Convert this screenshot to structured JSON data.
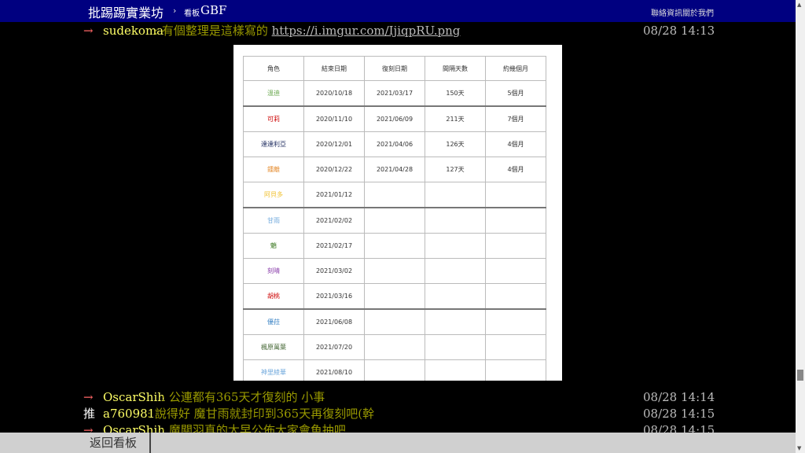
{
  "header": {
    "board_title": "批踢踢實業坊",
    "separator": "›",
    "board_label": "看板",
    "board_name": "GBF",
    "contact": "聯絡資訊",
    "about": "關於我們"
  },
  "pushes": [
    {
      "tag": "→",
      "user": "sudekoma",
      "message": "有個整理是這樣寫的 ",
      "link": "https://i.imgur.com/IjiqpRU.png",
      "time": "08/28 14:13"
    },
    {
      "tag": "→",
      "user": "OscarShih",
      "message": "公連都有365天才復刻的 小事",
      "time": "08/28 14:14"
    },
    {
      "tag": "推",
      "user": "a760981",
      "message": "說得好 魔甘雨就封印到365天再復刻吧(幹",
      "time": "08/28 14:15"
    },
    {
      "tag": "→",
      "user": "OscarShih",
      "message": "魔關羽真的太早公佈大家會魚抽吧",
      "time": "08/28 14:15"
    }
  ],
  "image_table": {
    "headers": [
      "角色",
      "結束日期",
      "復刻日期",
      "間隔天數",
      "約幾個月"
    ],
    "rows": [
      {
        "name": "溫迪",
        "color": "#6aa84f",
        "end": "2020/10/18",
        "rerun": "2021/03/17",
        "days": "150天",
        "months": "5個月"
      },
      {
        "name": "可莉",
        "color": "#cc0000",
        "end": "2020/11/10",
        "rerun": "2021/06/09",
        "days": "211天",
        "months": "7個月"
      },
      {
        "name": "達達利亞",
        "color": "#1c2a5e",
        "end": "2020/12/01",
        "rerun": "2021/04/06",
        "days": "126天",
        "months": "4個月"
      },
      {
        "name": "鍾離",
        "color": "#e69138",
        "end": "2020/12/22",
        "rerun": "2021/04/28",
        "days": "127天",
        "months": "4個月"
      },
      {
        "name": "阿貝多",
        "color": "#f1c232",
        "end": "2021/01/12",
        "rerun": "",
        "days": "",
        "months": ""
      },
      {
        "name": "甘雨",
        "color": "#6fa8dc",
        "end": "2021/02/02",
        "rerun": "",
        "days": "",
        "months": ""
      },
      {
        "name": "魈",
        "color": "#38761d",
        "end": "2021/02/17",
        "rerun": "",
        "days": "",
        "months": ""
      },
      {
        "name": "刻晴",
        "color": "#8e44ad",
        "end": "2021/03/02",
        "rerun": "",
        "days": "",
        "months": ""
      },
      {
        "name": "胡桃",
        "color": "#cc0000",
        "end": "2021/03/16",
        "rerun": "",
        "days": "",
        "months": ""
      },
      {
        "name": "優菈",
        "color": "#3d85c6",
        "end": "2021/06/08",
        "rerun": "",
        "days": "",
        "months": ""
      },
      {
        "name": "楓原萬葉",
        "color": "#4a6b3a",
        "end": "2021/07/20",
        "rerun": "",
        "days": "",
        "months": ""
      },
      {
        "name": "神里綾華",
        "color": "#6fa8dc",
        "end": "2021/08/10",
        "rerun": "",
        "days": "",
        "months": ""
      }
    ]
  },
  "footer": {
    "back_label": "返回看板"
  }
}
